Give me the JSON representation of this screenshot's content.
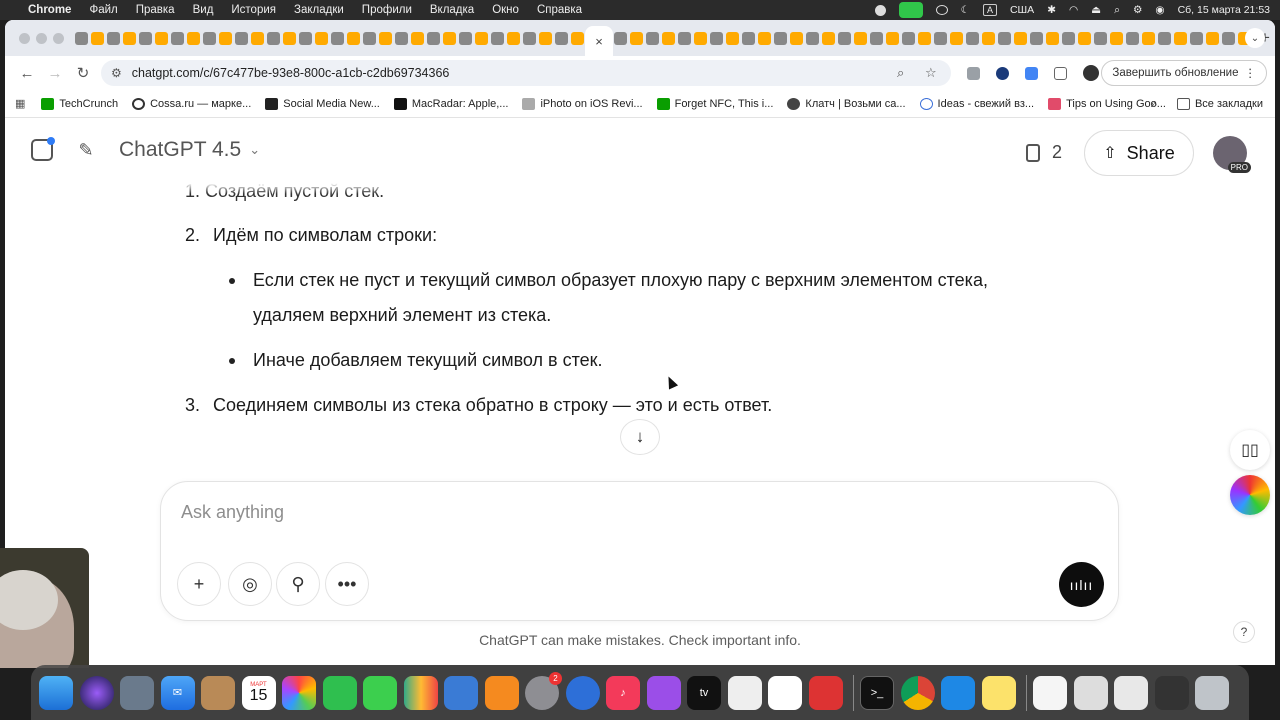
{
  "menubar": {
    "apple": "",
    "items": [
      "Chrome",
      "Файл",
      "Правка",
      "Вид",
      "История",
      "Закладки",
      "Профили",
      "Вкладка",
      "Окно",
      "Справка"
    ],
    "keyboard_label": "A",
    "locale": "США",
    "datetime": "Сб, 15 марта  21:53"
  },
  "browser": {
    "active_tab_close": "×",
    "new_tab": "+",
    "url": "chatgpt.com/c/67c477be-93e8-800c-a1cb-c2db69734366",
    "update_button": "Завершить обновление",
    "bookmarks": [
      "TechCrunch",
      "Cossa.ru — марке...",
      "Social Media New...",
      "MacRadar: Apple,...",
      "iPhoto on iOS Revi...",
      "Forget NFC, This i...",
      "Клатч | Возьми са...",
      "Ideas - свежий вз...",
      "Tips on Using Goo..."
    ],
    "bookmarks_more": "»",
    "all_bookmarks": "Все закладки"
  },
  "header": {
    "model": "ChatGPT 4.5",
    "docs_count": "2",
    "share": "Share",
    "avatar_badge": "PRO"
  },
  "chat": {
    "cut_line": "1.  Создаём пустой стек.",
    "item2_num": "2.",
    "item2": "Идём по символам строки:",
    "bullet1_line1": "Если стек не пуст и текущий символ образует плохую пару с верхним элементом стека,",
    "bullet1_line2": "удаляем верхний элемент из стека.",
    "bullet2": "Иначе добавляем текущий символ в стек.",
    "item3_num": "3.",
    "item3": "Соединяем символы из стека обратно в строку — это и есть ответ."
  },
  "composer": {
    "placeholder": "Ask anything"
  },
  "footer": {
    "disclaimer": "ChatGPT can make mistakes. Check important info.",
    "help": "?"
  },
  "dock": {
    "calendar_month": "МАРТ",
    "calendar_day": "15",
    "settings_badge": "2",
    "tv_label": "tv"
  },
  "colors": {
    "accent_blue": "#2f7cf6",
    "voice_button": "#0d0d0d",
    "text": "#1b1b1b"
  }
}
